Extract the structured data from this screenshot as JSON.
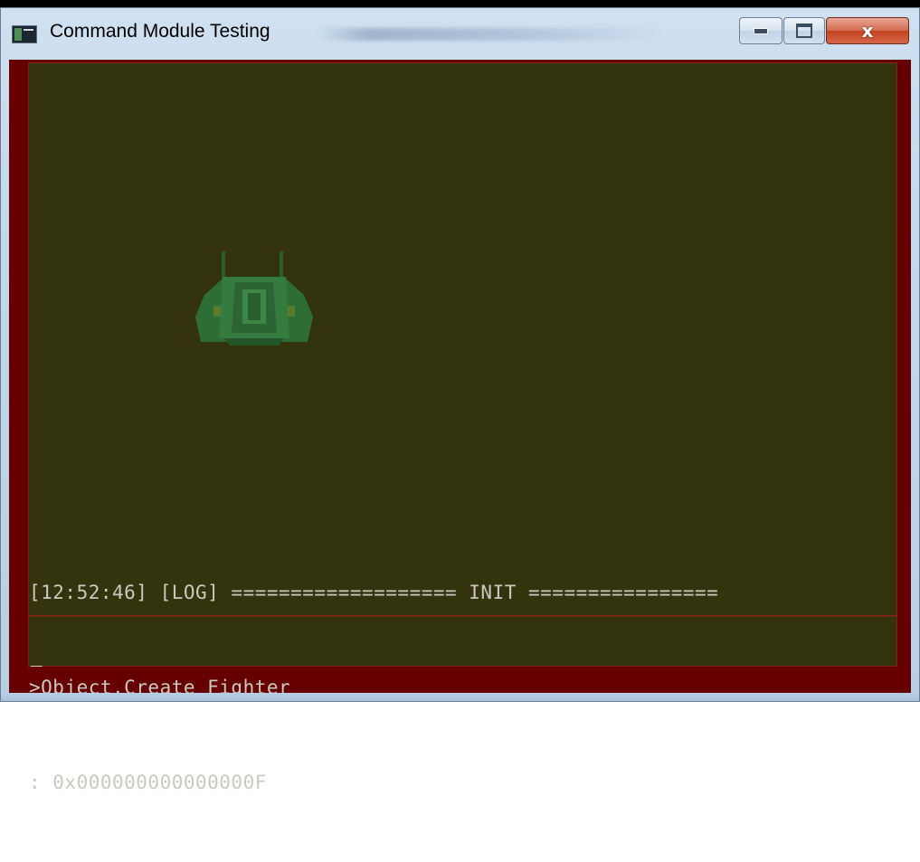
{
  "window": {
    "title": "Command Module Testing",
    "controls": {
      "minimize": "minimize",
      "maximize": "maximize",
      "close_glyph": "x"
    }
  },
  "colors": {
    "viewport_bg": "#33330d",
    "frame": "#660000",
    "console_text": "#c9c9c0",
    "ship": "#2e6b35"
  },
  "icons": [
    "app-icon",
    "fighter-ship-icon",
    "minimize-icon",
    "maximize-icon",
    "close-icon"
  ],
  "console": {
    "lines": [
      "[12:52:46] [LOG] =================== INIT ================",
      ">Object.Create Fighter",
      ": 0x000000000000000F"
    ],
    "input_value": "",
    "cursor": "_"
  }
}
